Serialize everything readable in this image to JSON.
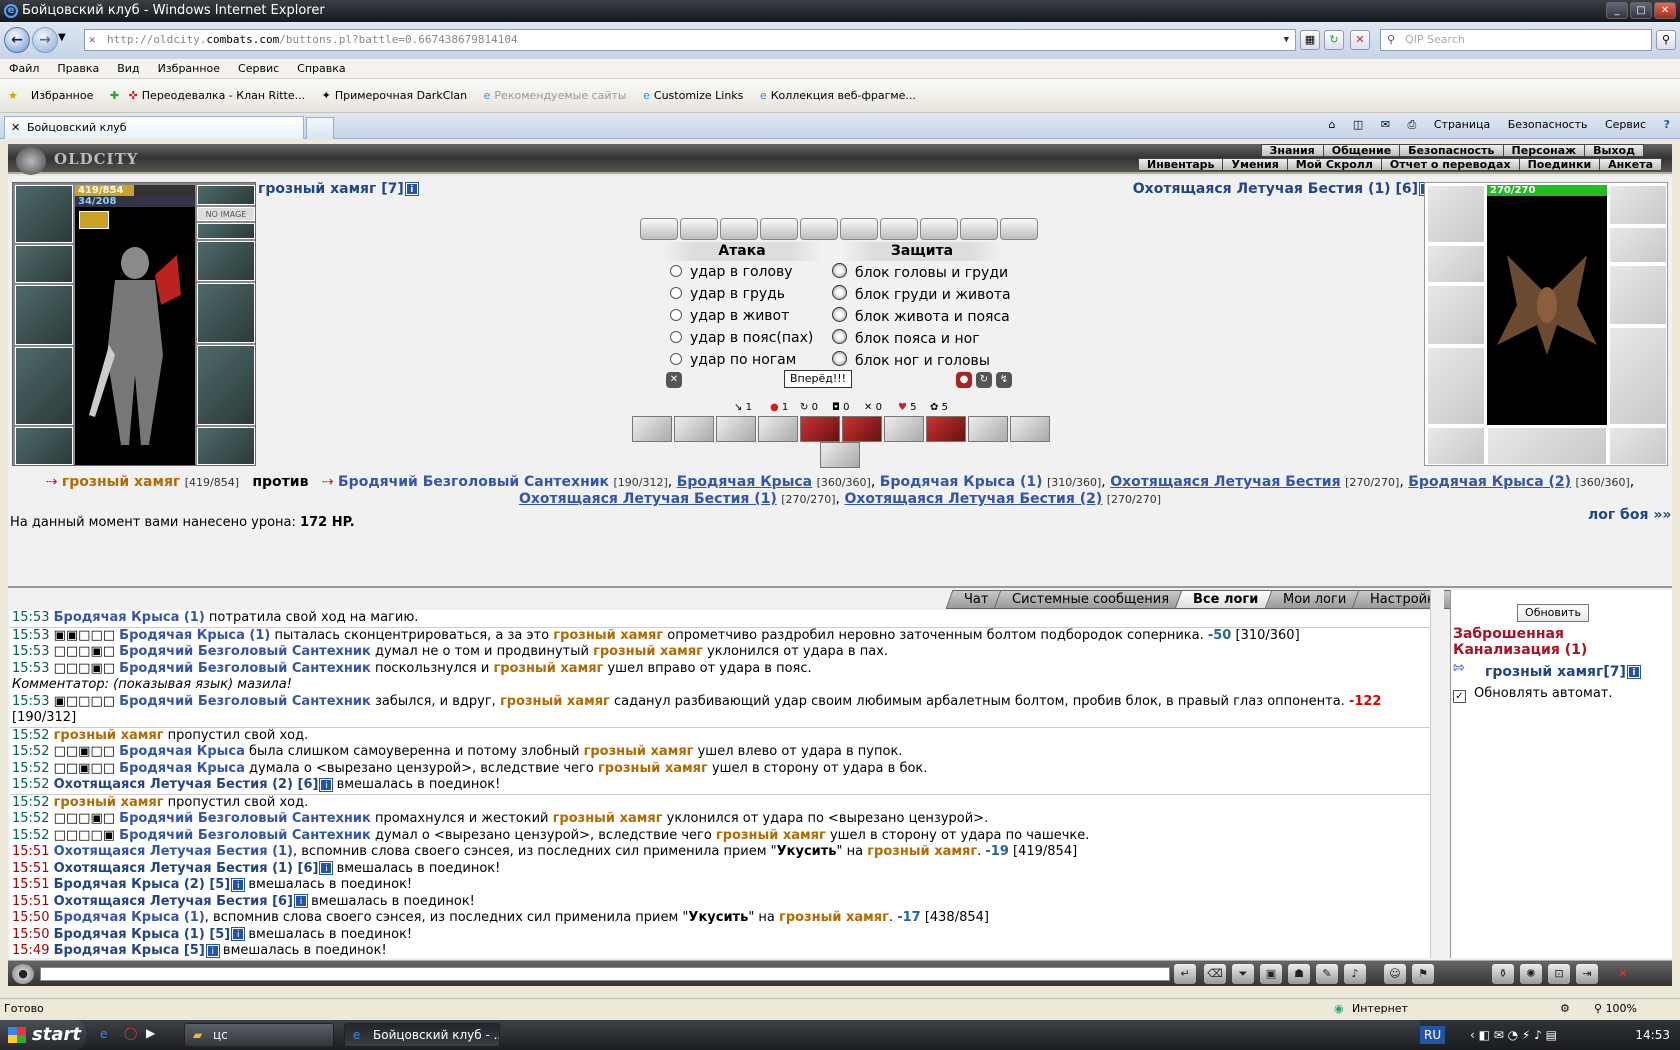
{
  "browser": {
    "title": "Бойцовский клуб - Windows Internet Explorer",
    "url_prefix": "http://oldcity.",
    "url_domain": "combats.com",
    "url_path": "/buttons.pl?battle=0.667438679814104",
    "search_placeholder": "QIP Search",
    "menu": [
      "Файл",
      "Правка",
      "Вид",
      "Избранное",
      "Сервис",
      "Справка"
    ],
    "favorites_label": "Избранное",
    "fav_links": [
      "Переодевалка - Клан Ritte...",
      "Примерочная DarkClan",
      "Рекомендуемые сайты",
      "Customize Links",
      "Коллекция веб-фрагме..."
    ],
    "tab_title": "Бойцовский клуб",
    "cmd": [
      "Страница",
      "Безопасность",
      "Сервис"
    ],
    "status": "Готово",
    "zone": "Интернет",
    "zoom": "100%"
  },
  "game": {
    "logo": "OLDCITY",
    "nav_top": [
      "Знания",
      "Общение",
      "Безопасность",
      "Персонаж",
      "Выход"
    ],
    "nav_bottom": [
      "Инвентарь",
      "Умения",
      "Мой Скролл",
      "Отчет о переводах",
      "Поединки",
      "Анкета"
    ],
    "player": {
      "name": "грозный хамяг [7]",
      "hp": "419/854",
      "mana": "34/208",
      "hp_fraction": 0.49
    },
    "noimage": "NO IMAGE",
    "enemy": {
      "name": "Охотящаяся Летучая Бестия (1) [6]",
      "hp": "270/270",
      "hp_fraction": 1.0
    },
    "attack_title": "Атака",
    "defense_title": "Защита",
    "attacks": [
      "удар в голову",
      "удар в грудь",
      "удар в живот",
      "удар в пояс(пах)",
      "удар по ногам"
    ],
    "defenses": [
      "блок головы и груди",
      "блок груди и живота",
      "блок живота и пояса",
      "блок пояса и ног",
      "блок ног и головы"
    ],
    "go_button": "Вперёд!!!",
    "stats": [
      "1",
      "1",
      "0",
      "0",
      "0",
      "5",
      "5"
    ],
    "vs": {
      "me": "грозный хамяг",
      "me_hp": "[419/854]",
      "against": "против",
      "enemies": [
        {
          "name": "Бродячий Безголовый Сантехник",
          "hp": "[190/312]"
        },
        {
          "name": "Бродячая Крыса",
          "hp": "[360/360]"
        },
        {
          "name": "Бродячая Крыса (1)",
          "hp": "[310/360]"
        },
        {
          "name": "Охотящаяся Летучая Бестия",
          "hp": "[270/270]"
        },
        {
          "name": "Бродячая Крыса (2)",
          "hp": "[360/360]"
        },
        {
          "name": "Охотящаяся Летучая Бестия (1)",
          "hp": "[270/270]"
        },
        {
          "name": "Охотящаяся Летучая Бестия (2)",
          "hp": "[270/270]"
        }
      ]
    },
    "damage_text": "На данный момент вами нанесено урона:",
    "damage_value": "172 HP.",
    "log_link": "лог боя »»",
    "log_tabs": [
      "Чат",
      "Системные сообщения",
      "Все логи",
      "Мои логи",
      "Настройки"
    ],
    "log": [
      {
        "t": "15:53",
        "html": "<span class='c-en'>Бродячая Крыса (1)</span> потратила свой ход на магию."
      },
      {
        "t": "15:53",
        "html": "▣▣□□□ <span class='c-en'>Бродячая Крыса (1)</span> пыталась сконцентрироваться, а за это <span class='c-me'>грозный хамяг</span> опрометчиво раздробил неровно заточенным болтом подбородок соперника. <span class='c-dmg'>-50</span> [310/360]",
        "sep": true
      },
      {
        "t": "15:53",
        "html": "□□□▣□ <span class='c-en'>Бродячий Безголовый Сантехник</span> думал не о том и продвинутый <span class='c-me'>грозный хамяг</span> уклонился от удара в пах."
      },
      {
        "t": "15:53",
        "html": "□□□▣□ <span class='c-en'>Бродячий Безголовый Сантехник</span> поскользнулся и <span class='c-me'>грозный хамяг</span> ушел вправо от удара в пояс."
      },
      {
        "t": "",
        "html": "<i>Комментатор: (показывая язык) мазила!</i>"
      },
      {
        "t": "15:53",
        "html": "▣□□□□ <span class='c-en'>Бродячий Безголовый Сантехник</span> забылся, и вдруг, <span class='c-me'>грозный хамяг</span> саданул разбивающий удар своим любимым арбалетным болтом, пробив блок, в правый глаз оппонента. <span class='c-dmgr'>-122</span>"
      },
      {
        "t": "",
        "html": "[190/312]"
      },
      {
        "t": "15:52",
        "html": "<span class='c-me'>грозный хамяг</span> пропустил свой ход.",
        "sep": true
      },
      {
        "t": "15:52",
        "html": "□□▣□□ <span class='c-en'>Бродячая Крыса</span> была слишком самоуверенна и потому злобный <span class='c-me'>грозный хамяг</span> ушел влево от удара в пупок."
      },
      {
        "t": "15:52",
        "html": "□□▣□□ <span class='c-en'>Бродячая Крыса</span> думала о &lt;вырезано цензурой&gt;, вследствие чего <span class='c-me'>грозный хамяг</span> ушел в сторону от удара в бок."
      },
      {
        "t": "15:52",
        "html": "<span class='c-en2'>Охотящаяся Летучая Бестия (2) [6]</span><span class='info'>i</span> вмешалась в поединок!"
      },
      {
        "t": "15:52",
        "html": "<span class='c-me'>грозный хамяг</span> пропустил свой ход.",
        "sep": true
      },
      {
        "t": "15:52",
        "html": "□□□▣□ <span class='c-en'>Бродячий Безголовый Сантехник</span> промахнулся и жестокий <span class='c-me'>грозный хамяг</span> уклонился от удара по &lt;вырезано цензурой&gt;."
      },
      {
        "t": "15:52",
        "html": "□□□□▣ <span class='c-en'>Бродячий Безголовый Сантехник</span> думал о &lt;вырезано цензурой&gt;, вследствие чего <span class='c-me'>грозный хамяг</span> ушел в сторону от удара по чашечке."
      },
      {
        "t": "15:51",
        "html": "<span class='c-en'>Охотящаяся Летучая Бестия (1)</span>, вспомнив слова своего сэнсея, из последних сил применила прием \"<b>Укусить</b>\" на <span class='c-me'>грозный хамяг</span>. <span class='c-dmg'>-19</span> [419/854]"
      },
      {
        "t": "15:51",
        "html": "<span class='c-en2'>Охотящаяся Летучая Бестия (1) [6]</span><span class='info'>i</span> вмешалась в поединок!"
      },
      {
        "t": "15:51",
        "html": "<span class='c-en2'>Бродячая Крыса (2) [5]</span><span class='info'>i</span> вмешалась в поединок!"
      },
      {
        "t": "15:51",
        "html": "<span class='c-en2'>Охотящаяся Летучая Бестия [6]</span><span class='info'>i</span> вмешалась в поединок!"
      },
      {
        "t": "15:50",
        "html": "<span class='c-en'>Бродячая Крыса (1)</span>, вспомнив слова своего сэнсея, из последних сил применила прием \"<b>Укусить</b>\" на <span class='c-me'>грозный хамяг</span>. <span class='c-dmg'>-17</span> [438/854]"
      },
      {
        "t": "15:50",
        "html": "<span class='c-en2'>Бродячая Крыса (1) [5]</span><span class='info'>i</span> вмешалась в поединок!"
      },
      {
        "t": "15:49",
        "html": "<span class='c-en2'>Бродячая Крыса [5]</span><span class='info'>i</span> вмешалась в поединок!"
      }
    ],
    "side": {
      "refresh": "Обновить",
      "location": "Заброшенная Канализация (1)",
      "player": "грозный хамяг[7]",
      "auto": "Обновлять автомат."
    }
  },
  "taskbar": {
    "start": "start",
    "items": [
      "цс",
      "Бойцовский клуб - ..."
    ],
    "lang": "RU",
    "clock": "14:53"
  }
}
